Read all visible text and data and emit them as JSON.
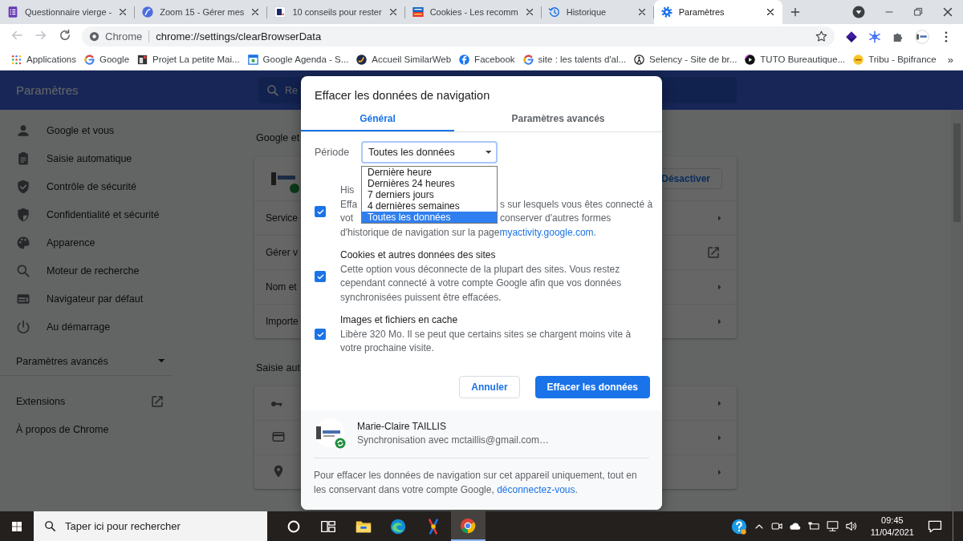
{
  "browser": {
    "tabs": [
      {
        "title": "Questionnaire vierge -",
        "kind": "forms",
        "selected": false
      },
      {
        "title": "Zoom 15 - Gérer mes",
        "kind": "zoom",
        "selected": false
      },
      {
        "title": "10 conseils pour rester",
        "kind": "letter",
        "selected": false
      },
      {
        "title": "Cookies - Les recomm",
        "kind": "news",
        "selected": false
      },
      {
        "title": "Historique",
        "kind": "history",
        "selected": false
      },
      {
        "title": "Paramètres",
        "kind": "settings",
        "selected": true
      }
    ],
    "omnibox": {
      "chip": "Chrome",
      "url": "chrome://settings/clearBrowserData"
    },
    "bookmarks": [
      {
        "label": "Applications",
        "kind": "apps"
      },
      {
        "label": "Google",
        "kind": "google"
      },
      {
        "label": "Projet La petite Mai...",
        "kind": "thumb"
      },
      {
        "label": "Google Agenda - S...",
        "kind": "calendar"
      },
      {
        "label": "Accueil SimilarWeb",
        "kind": "swoosh"
      },
      {
        "label": "Facebook",
        "kind": "fb"
      },
      {
        "label": "site : les talents d'al...",
        "kind": "google"
      },
      {
        "label": "Selency - Site de br...",
        "kind": "figure"
      },
      {
        "label": "TUTO Bureautique...",
        "kind": "play"
      },
      {
        "label": "Tribu - Bpifrance",
        "kind": "tribu"
      }
    ],
    "bookmarks_more": "»"
  },
  "settings": {
    "header_title": "Paramètres",
    "search": {
      "placeholder": "Re"
    },
    "sidebar": {
      "items": [
        {
          "label": "Google et vous",
          "kind": "person"
        },
        {
          "label": "Saisie automatique",
          "kind": "clipboard"
        },
        {
          "label": "Contrôle de sécurité",
          "kind": "shieldcheck"
        },
        {
          "label": "Confidentialité et sécurité",
          "kind": "shieldhalf"
        },
        {
          "label": "Apparence",
          "kind": "palette"
        },
        {
          "label": "Moteur de recherche",
          "kind": "search"
        },
        {
          "label": "Navigateur par défaut",
          "kind": "browser"
        },
        {
          "label": "Au démarrage",
          "kind": "power"
        }
      ],
      "advanced": "Paramètres avancés",
      "extensions": "Extensions",
      "about": "À propos de Chrome"
    },
    "sections": [
      {
        "title": "Google et",
        "rows": [
          {
            "kind": "account",
            "button": "Désactiver"
          },
          {
            "kind": "submenu",
            "label": "Service"
          },
          {
            "kind": "external",
            "label": "Gérer v"
          },
          {
            "kind": "submenu",
            "label": "Nom et"
          },
          {
            "kind": "submenu",
            "label": "Importe"
          }
        ]
      },
      {
        "title": "Saisie aut",
        "rows": [
          {
            "kind": "key"
          },
          {
            "kind": "card"
          },
          {
            "kind": "pin"
          }
        ]
      }
    ]
  },
  "dialog": {
    "title": "Effacer les données de navigation",
    "tabs": [
      {
        "label": "Général",
        "selected": true
      },
      {
        "label": "Paramètres avancés",
        "selected": false
      }
    ],
    "period": {
      "label": "Période",
      "value": "Toutes les données",
      "options": [
        {
          "label": "Dernière heure",
          "selected": false
        },
        {
          "label": "Dernières 24 heures",
          "selected": false
        },
        {
          "label": "7 derniers jours",
          "selected": false
        },
        {
          "label": "4 dernières semaines",
          "selected": false
        },
        {
          "label": "Toutes les données",
          "selected": true
        }
      ]
    },
    "history": {
      "checked": true,
      "title": "His",
      "lines": [
        {
          "left": "Effa",
          "right": "s sur lesquels vous êtes connecté à"
        },
        {
          "left": "vot",
          "right": "conserver d'autres formes"
        }
      ],
      "last_line": "d'historique de navigation sur la page ",
      "link": "myactivity.google.com",
      "after_link": "."
    },
    "items": [
      {
        "title": "Cookies et autres données des sites",
        "description": "Cette option vous déconnecte de la plupart des sites. Vous restez cependant connecté à votre compte Google afin que vos données synchronisées puissent être effacées.",
        "checked": true
      },
      {
        "title": "Images et fichiers en cache",
        "description": "Libère 320 Mo. Il se peut que certains sites se chargent moins vite à votre prochaine visite.",
        "checked": true
      }
    ],
    "cancel": "Annuler",
    "confirm": "Effacer les données",
    "account": {
      "name": "Marie-Claire TAILLIS",
      "sync": "Synchronisation avec mctaillis@gmail.com…"
    },
    "note": {
      "text": "Pour effacer les données de navigation sur cet appareil uniquement, tout en les conservant dans votre compte Google, ",
      "link": "déconnectez-vous",
      "after": "."
    }
  },
  "taskbar": {
    "search_placeholder": "Taper ici pour rechercher",
    "apps": [
      {
        "kind": "cortana",
        "selected": false
      },
      {
        "kind": "taskview",
        "selected": false
      },
      {
        "kind": "explorer",
        "selected": false
      },
      {
        "kind": "edge",
        "selected": false
      },
      {
        "kind": "app",
        "selected": false
      },
      {
        "kind": "chrome",
        "selected": true
      }
    ],
    "time": "09:45",
    "date": "11/04/2021"
  }
}
